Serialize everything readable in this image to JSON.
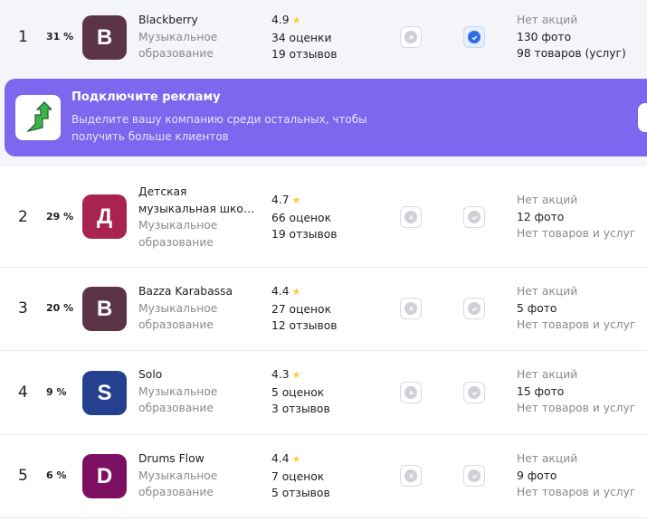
{
  "colors": {
    "promo_bg": "#7b68ee",
    "star": "#fccc3d",
    "checked": "#2f6ce6",
    "muted_text": "#8a8a8e"
  },
  "promo": {
    "title": "Подключите рекламу",
    "text": "Выделите вашу компанию среди остальных, чтобы получить больше клиентов",
    "icon": "arrow-up-growth-icon"
  },
  "rows": [
    {
      "rank": "1",
      "percent": "31 %",
      "avatar_letter": "B",
      "avatar_color": "#5c3447",
      "name": "Blackberry",
      "name_line2": "",
      "category_line1": "Музыкальное",
      "category_line2": "образование",
      "rating": "4.9",
      "ratings_count": "34 оценки",
      "reviews_count": "19 отзывов",
      "verified": true,
      "promotions": "Нет акций",
      "photos": "130 фото",
      "goods": "98 товаров (услуг)"
    },
    {
      "rank": "2",
      "percent": "29 %",
      "avatar_letter": "Д",
      "avatar_color": "#a8234f",
      "name": "Детская",
      "name_line2": "музыкальная школ...",
      "category_line1": "Музыкальное",
      "category_line2": "образование",
      "rating": "4.7",
      "ratings_count": "66 оценок",
      "reviews_count": "19 отзывов",
      "verified": false,
      "promotions": "Нет акций",
      "photos": "12 фото",
      "goods": "Нет товаров и услуг"
    },
    {
      "rank": "3",
      "percent": "20 %",
      "avatar_letter": "B",
      "avatar_color": "#5c3447",
      "name": "Bazza Karabassa",
      "name_line2": "",
      "category_line1": "Музыкальное",
      "category_line2": "образование",
      "rating": "4.4",
      "ratings_count": "27 оценок",
      "reviews_count": "12 отзывов",
      "verified": false,
      "promotions": "Нет акций",
      "photos": "5 фото",
      "goods": "Нет товаров и услуг"
    },
    {
      "rank": "4",
      "percent": "9 %",
      "avatar_letter": "S",
      "avatar_color": "#24408e",
      "name": "Solo",
      "name_line2": "",
      "category_line1": "Музыкальное",
      "category_line2": "образование",
      "rating": "4.3",
      "ratings_count": "5 оценок",
      "reviews_count": "3 отзывов",
      "verified": false,
      "promotions": "Нет акций",
      "photos": "15 фото",
      "goods": "Нет товаров и услуг"
    },
    {
      "rank": "5",
      "percent": "6 %",
      "avatar_letter": "D",
      "avatar_color": "#7d0f63",
      "name": "Drums Flow",
      "name_line2": "",
      "category_line1": "Музыкальное",
      "category_line2": "образование",
      "rating": "4.4",
      "ratings_count": "7 оценок",
      "reviews_count": "5 отзывов",
      "verified": false,
      "promotions": "Нет акций",
      "photos": "9 фото",
      "goods": "Нет товаров и услуг"
    }
  ]
}
